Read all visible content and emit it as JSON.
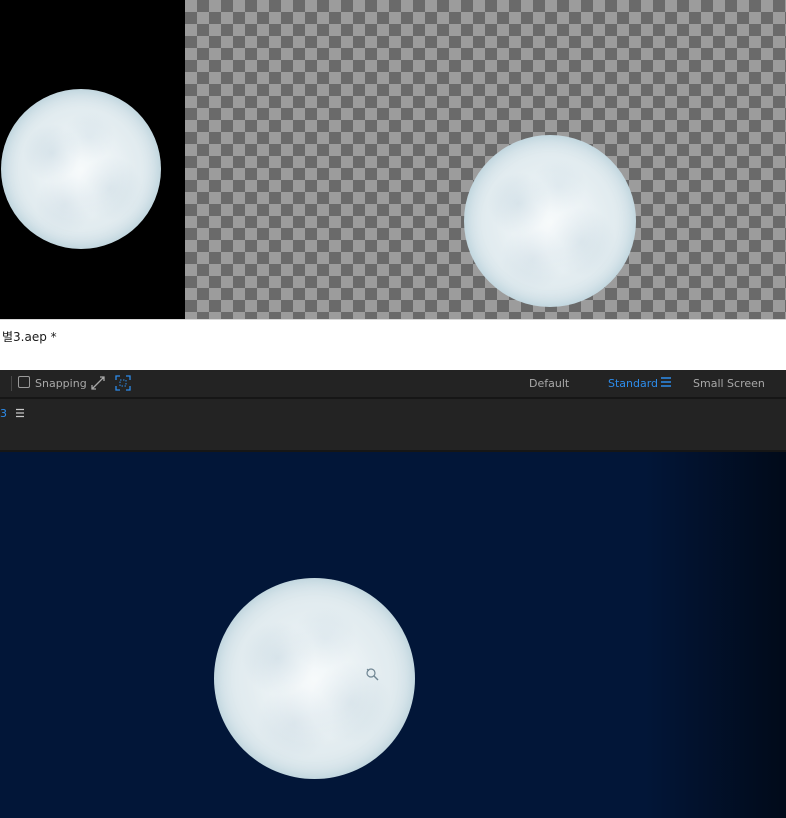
{
  "project": {
    "title": "별3.aep *"
  },
  "toolbar": {
    "snapping_label": "Snapping",
    "snapping_checked": false,
    "icons": [
      "expand-arrows-icon",
      "region-select-icon"
    ]
  },
  "workspaces": {
    "items": [
      "Default",
      "Standard",
      "Small Screen"
    ],
    "active": "Standard",
    "accent_color": "#2d8ceb"
  },
  "panel": {
    "tab_label": "3"
  },
  "viewer": {
    "background_color": "#021638"
  },
  "preview": {
    "left_background": "#000000",
    "transparency_grid": "checkerboard"
  }
}
